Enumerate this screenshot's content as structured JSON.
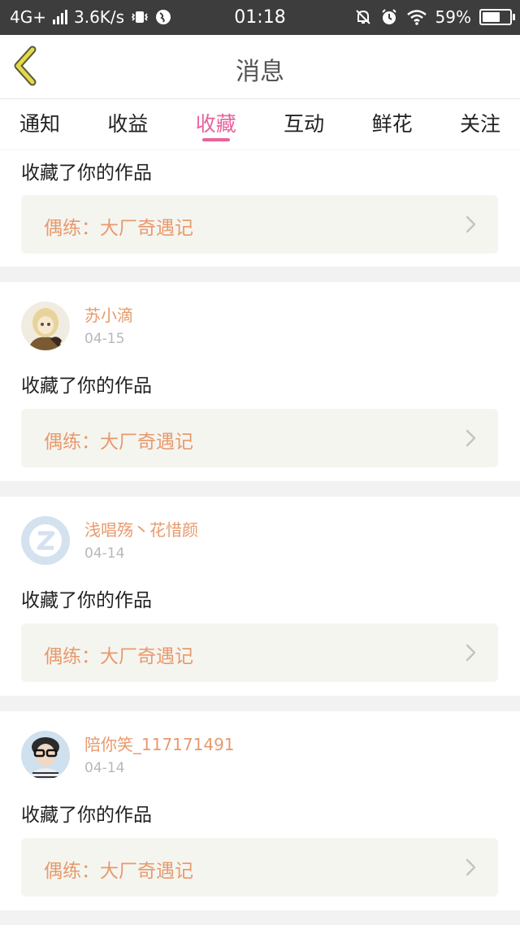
{
  "status_bar": {
    "network": "4G+",
    "speed": "3.6K/s",
    "time": "01:18",
    "battery": "59%",
    "icons": [
      "signal-icon",
      "vibrate-icon",
      "vpn-icon",
      "mute-notification-icon",
      "alarm-icon",
      "wifi-icon",
      "battery-icon"
    ]
  },
  "header": {
    "title": "消息",
    "back_icon": "chevron-left-icon",
    "accent": "#e5d94a"
  },
  "tabs": [
    {
      "label": "通知"
    },
    {
      "label": "收益"
    },
    {
      "label": "收藏"
    },
    {
      "label": "互动"
    },
    {
      "label": "鲜花"
    },
    {
      "label": "关注"
    }
  ],
  "active_tab": "收藏",
  "colors": {
    "active_tab": "#e6649c",
    "username": "#e79a6d",
    "work_title": "#e79a6d"
  },
  "cards": [
    {
      "message": "收藏了你的作品",
      "work": "偶练：大厂奇遇记"
    },
    {
      "username": "苏小滴",
      "date": "04-15",
      "message": "收藏了你的作品",
      "work": "偶练：大厂奇遇记"
    },
    {
      "username": "浅唱殇丶花惜颜",
      "date": "04-14",
      "message": "收藏了你的作品",
      "work": "偶练：大厂奇遇记"
    },
    {
      "username": "陪你笑_117171491",
      "date": "04-14",
      "message": "收藏了你的作品",
      "work": "偶练：大厂奇遇记"
    }
  ]
}
